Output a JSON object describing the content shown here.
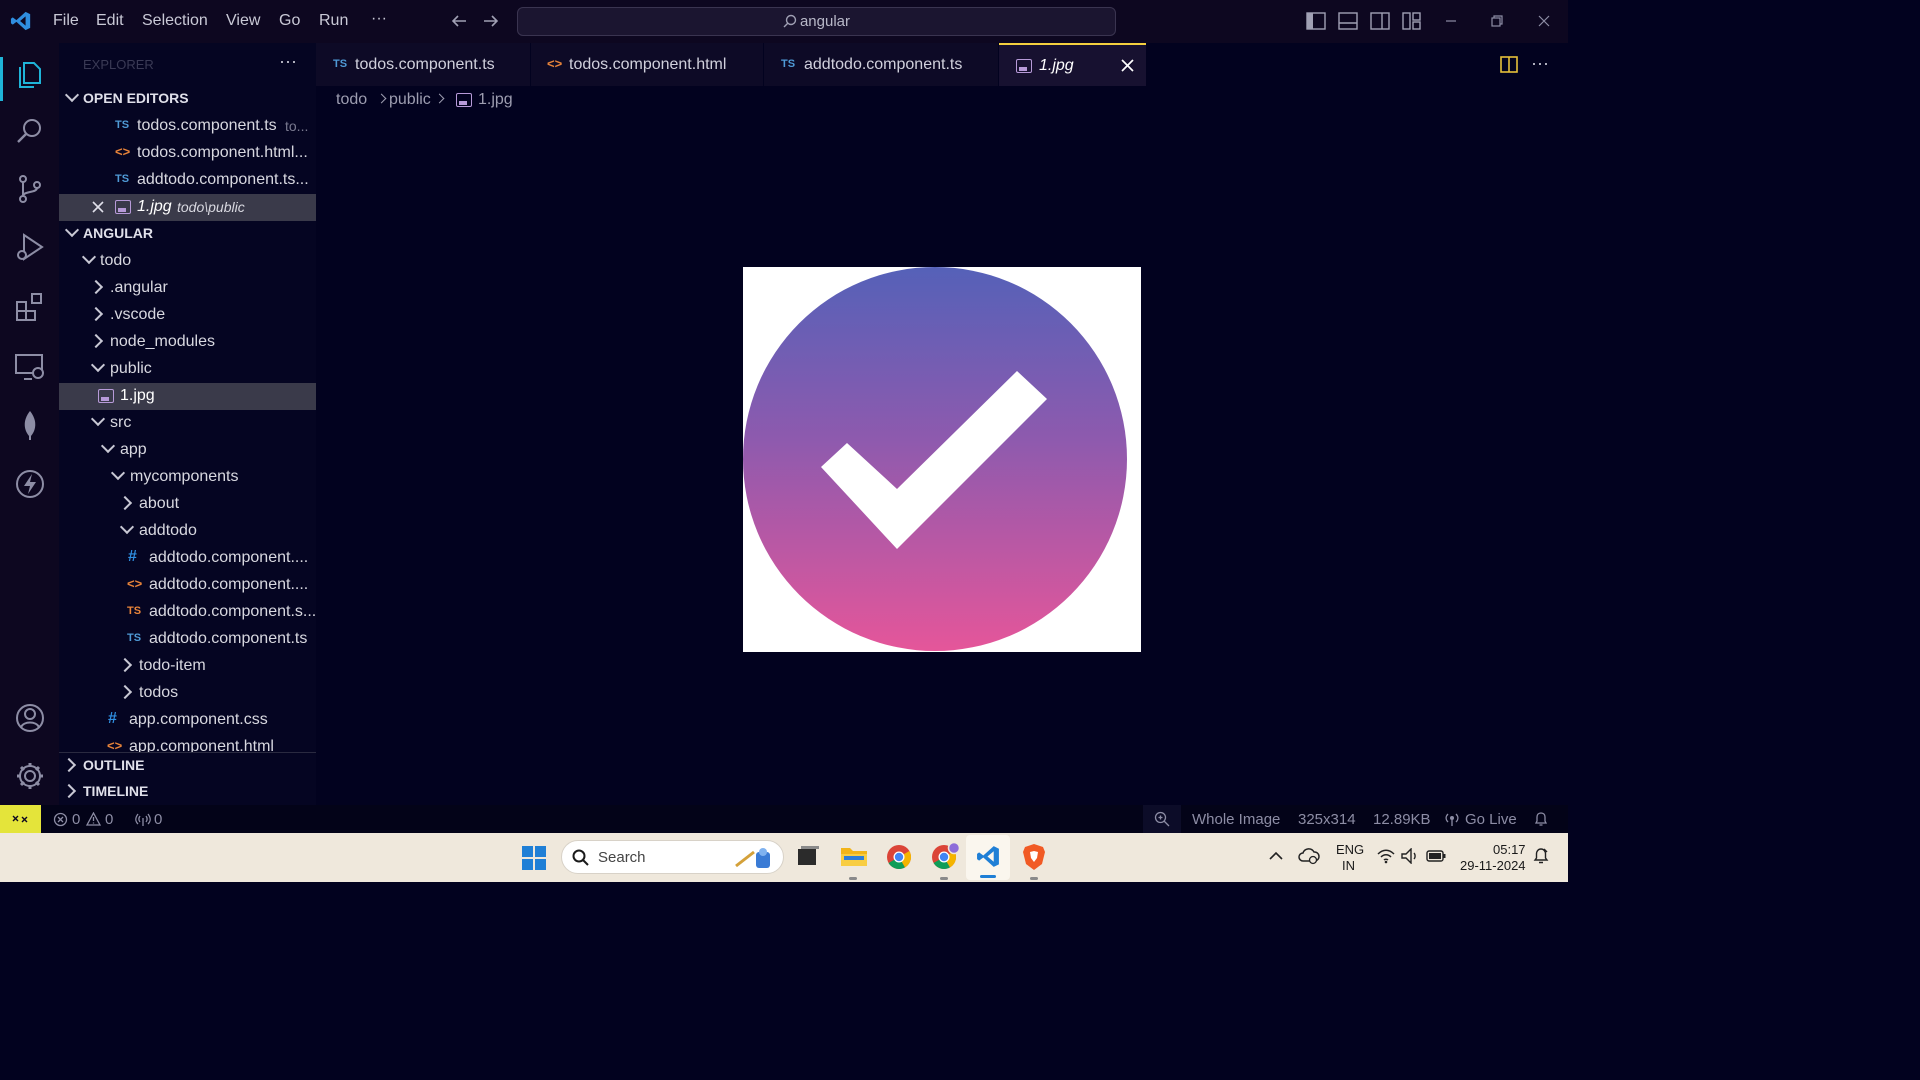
{
  "titlebar": {
    "menu": [
      "File",
      "Edit",
      "Selection",
      "View",
      "Go",
      "Run",
      "···"
    ],
    "search_text": "angular"
  },
  "activitybar": {
    "icons": [
      "explorer-icon",
      "search-icon",
      "source-control-icon",
      "run-debug-icon",
      "extensions-icon",
      "remote-explorer-icon",
      "mongodb-icon",
      "thunder-client-icon",
      "account-icon",
      "settings-gear-icon"
    ]
  },
  "sidebar": {
    "title": "EXPLORER",
    "more": "···",
    "open_editors": {
      "label": "OPEN EDITORS",
      "items": [
        {
          "name": "todos.component.ts",
          "desc": "to..."
        },
        {
          "name": "todos.component.html...",
          "desc": ""
        },
        {
          "name": "addtodo.component.ts...",
          "desc": ""
        },
        {
          "name": "1.jpg",
          "desc": "todo\\public"
        }
      ]
    },
    "workspace": {
      "label": "ANGULAR",
      "tree": [
        "todo",
        ".angular",
        ".vscode",
        "node_modules",
        "public",
        "1.jpg",
        "src",
        "app",
        "mycomponents",
        "about",
        "addtodo",
        "addtodo.component....",
        "addtodo.component....",
        "addtodo.component.s...",
        "addtodo.component.ts",
        "todo-item",
        "todos",
        "app.component.css",
        "app.component.html"
      ]
    },
    "outline": "OUTLINE",
    "timeline": "TIMELINE"
  },
  "tabs": [
    {
      "icon": "TS",
      "label": "todos.component.ts"
    },
    {
      "icon": "<>",
      "label": "todos.component.html"
    },
    {
      "icon": "TS",
      "label": "addtodo.component.ts"
    },
    {
      "icon": "img",
      "label": "1.jpg",
      "active": true
    }
  ],
  "breadcrumb": [
    "todo",
    "public",
    "1.jpg"
  ],
  "statusbar": {
    "errors": "0",
    "warnings": "0",
    "ports": "0",
    "zoom": "Whole Image",
    "dimensions": "325x314",
    "size": "12.89KB",
    "golive": "Go Live"
  },
  "taskbar": {
    "search": "Search",
    "lang_top": "ENG",
    "lang_bottom": "IN",
    "time": "05:17",
    "date": "29-11-2024"
  },
  "colors": {
    "accent": "#f4d03f",
    "status_remote": "#e4e43a",
    "editor_bg": "#02021f"
  }
}
